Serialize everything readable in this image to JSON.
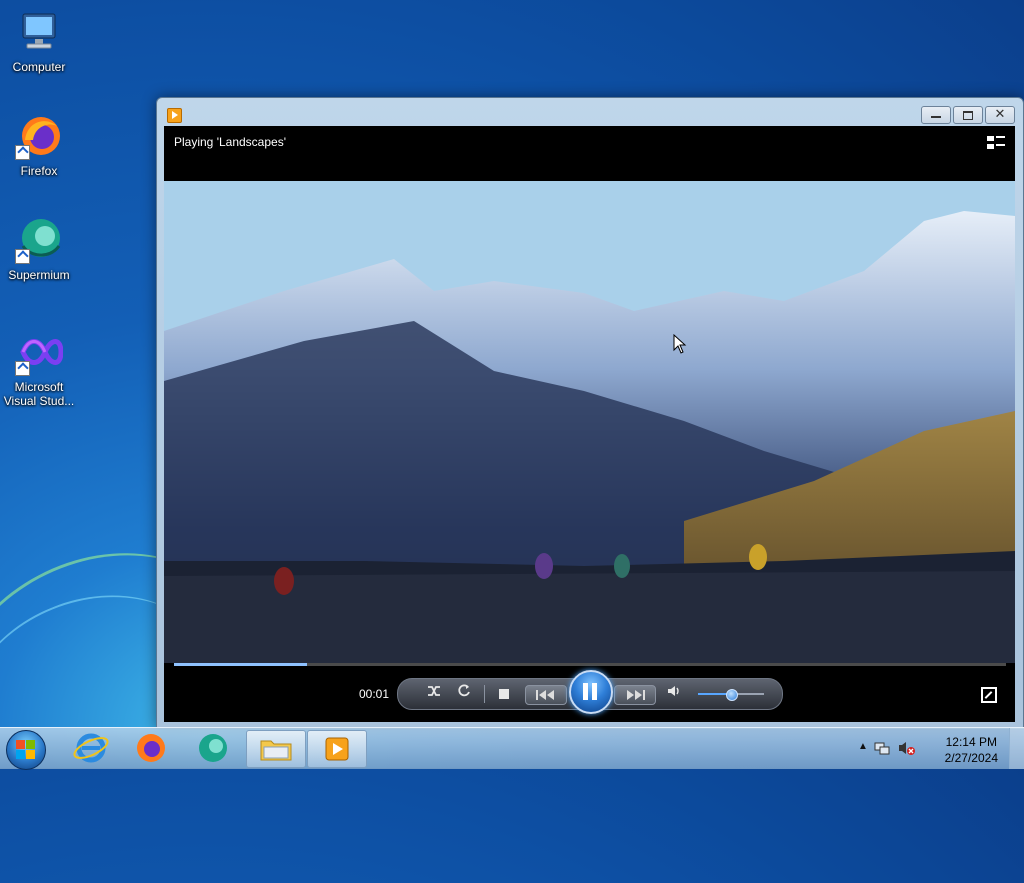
{
  "desktop": {
    "icons": [
      {
        "label": "Computer"
      },
      {
        "label": "Firefox"
      },
      {
        "label": "Supermium"
      },
      {
        "label": "Microsoft Visual Stud..."
      }
    ]
  },
  "player": {
    "now_playing": "Playing 'Landscapes'",
    "elapsed": "00:01",
    "progress_fraction": 0.16,
    "volume_fraction": 0.5,
    "state": "playing"
  },
  "taskbar": {
    "clock_time": "12:14 PM",
    "clock_date": "2/27/2024"
  },
  "colors": {
    "accent": "#2f7fd8",
    "desktop_blue": "#135fb6"
  }
}
